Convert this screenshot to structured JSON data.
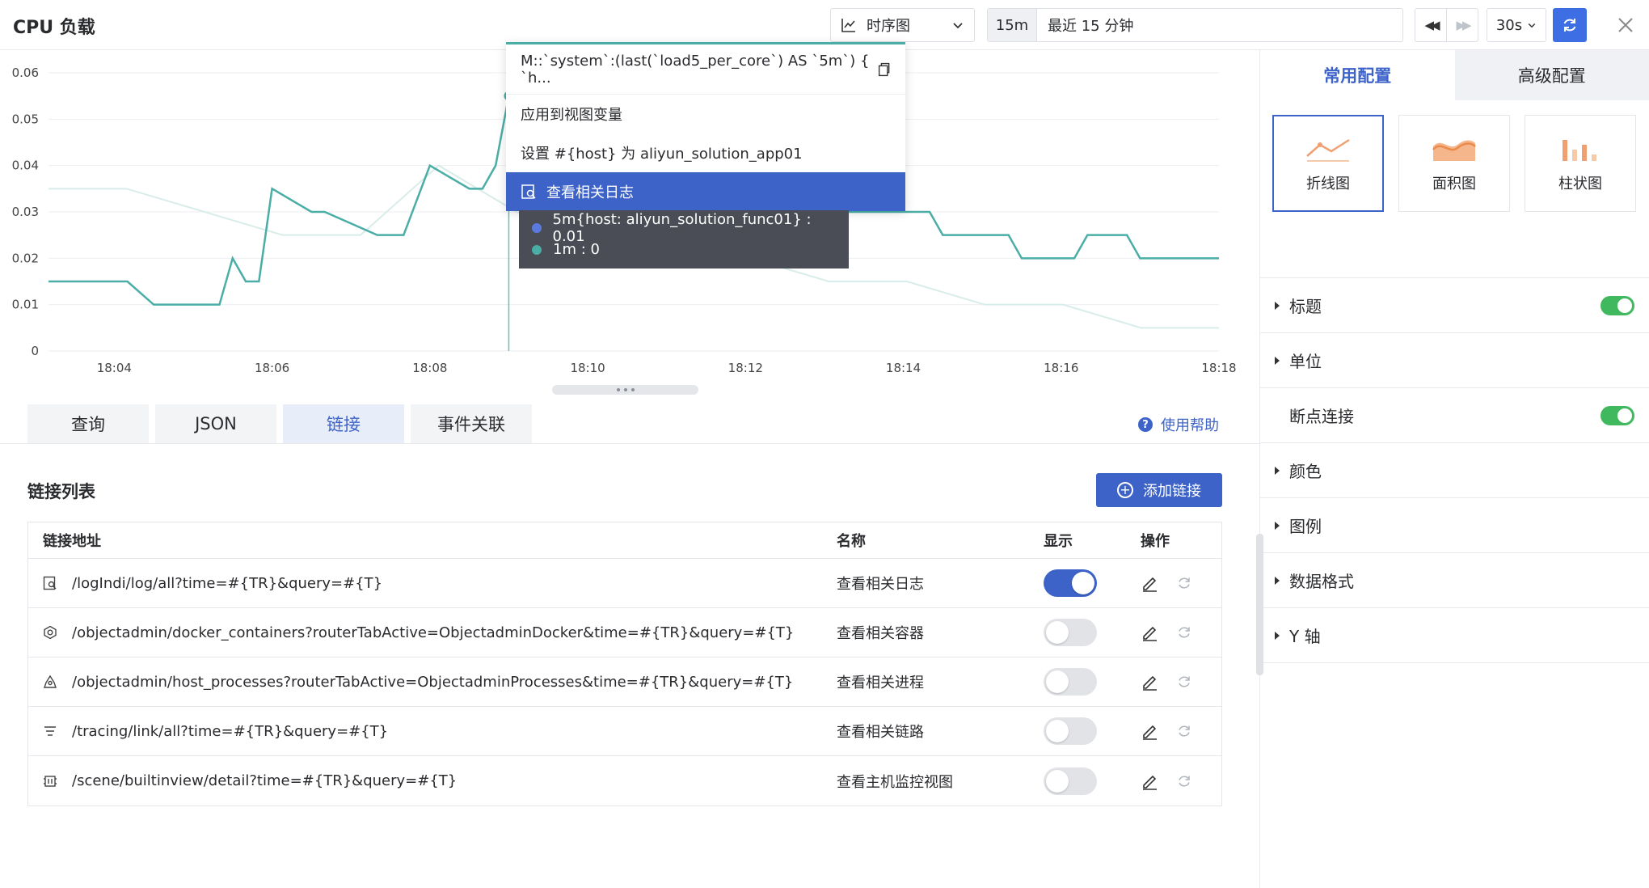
{
  "header": {
    "title": "CPU 负载",
    "viz_type": "时序图",
    "time_short": "15m",
    "time_long": "最近 15 分钟",
    "interval": "30s"
  },
  "colors": {
    "accent": "#3d63c9",
    "series_teal": "#4aada6",
    "series_blue": "#5b7ae0",
    "toggle_green": "#3fb85e"
  },
  "chart": {
    "y_ticks": [
      "0.06",
      "0.05",
      "0.04",
      "0.03",
      "0.02",
      "0.01",
      "0"
    ],
    "x_ticks": [
      "18:04",
      "18:06",
      "18:08",
      "18:10",
      "18:12",
      "18:14",
      "18:16",
      "18:18"
    ]
  },
  "chart_data": {
    "type": "line",
    "ylim": [
      0,
      0.06
    ],
    "series": [
      {
        "name": "1m",
        "color": "#4aada6",
        "x": [
          "18:03:10",
          "18:04:10",
          "18:04:30",
          "18:05:00",
          "18:05:10",
          "18:05:20",
          "18:05:30",
          "18:05:40",
          "18:05:50",
          "18:06:00",
          "18:06:30",
          "18:06:40",
          "18:07:20",
          "18:07:30",
          "18:07:40",
          "18:08:00",
          "18:08:30",
          "18:08:40",
          "18:08:50",
          "18:09:00",
          "18:09:20",
          "18:10:00",
          "18:10:30",
          "18:11:00",
          "18:11:30",
          "18:12:00",
          "18:12:30",
          "18:13:00",
          "18:13:20",
          "18:13:30",
          "18:14:00",
          "18:14:20",
          "18:14:30",
          "18:15:00",
          "18:15:20",
          "18:15:30",
          "18:16:00",
          "18:16:10",
          "18:16:20",
          "18:16:50",
          "18:17:00",
          "18:17:10",
          "18:18:00"
        ],
        "values": [
          0.015,
          0.015,
          0.01,
          0.01,
          0.01,
          0.01,
          0.02,
          0.015,
          0.015,
          0.035,
          0.03,
          0.03,
          0.025,
          0.025,
          0.025,
          0.04,
          0.035,
          0.035,
          0.04,
          0.055,
          0.04,
          0.035,
          0.035,
          0.03,
          0.03,
          0.03,
          0.03,
          0.03,
          0.03,
          0.03,
          0.03,
          0.03,
          0.025,
          0.025,
          0.025,
          0.02,
          0.02,
          0.02,
          0.025,
          0.025,
          0.02,
          0.02,
          0.02
        ]
      },
      {
        "name": "5m{host: aliyun_solution_func01}",
        "color": "#5b7ae0",
        "x": [
          "18:09:00"
        ],
        "values": [
          0.01
        ]
      }
    ]
  },
  "popup": {
    "query": "M::`system`:(last(`load5_per_core`) AS `5m`) { `h...",
    "item_apply": "应用到视图变量",
    "item_set": "设置 #{host} 为 aliyun_solution_app01",
    "item_logs": "查看相关日志"
  },
  "tooltip": {
    "line1": "5m{host: aliyun_solution_func01} : 0.01",
    "line2": "1m : 0"
  },
  "tabs": [
    {
      "label": "查询"
    },
    {
      "label": "JSON"
    },
    {
      "label": "链接"
    },
    {
      "label": "事件关联"
    }
  ],
  "help_label": "使用帮助",
  "links": {
    "title": "链接列表",
    "add_label": "添加链接",
    "headers": {
      "url": "链接地址",
      "name": "名称",
      "show": "显示",
      "op": "操作"
    },
    "rows": [
      {
        "icon": "log-search-icon",
        "url": "/logIndi/log/all?time=#{TR}&query=#{T}",
        "name": "查看相关日志",
        "show": true
      },
      {
        "icon": "container-icon",
        "url": "/objectadmin/docker_containers?routerTabActive=ObjectadminDocker&time=#{TR}&query=#{T}",
        "name": "查看相关容器",
        "show": false
      },
      {
        "icon": "process-icon",
        "url": "/objectadmin/host_processes?routerTabActive=ObjectadminProcesses&time=#{TR}&query=#{T}",
        "name": "查看相关进程",
        "show": false
      },
      {
        "icon": "trace-icon",
        "url": "/tracing/link/all?time=#{TR}&query=#{T}",
        "name": "查看相关链路",
        "show": false
      },
      {
        "icon": "host-icon",
        "url": "/scene/builtinview/detail?time=#{TR}&query=#{T}",
        "name": "查看主机监控视图",
        "show": false
      }
    ]
  },
  "config": {
    "tab_common": "常用配置",
    "tab_advanced": "高级配置",
    "chart_types": [
      {
        "label": "折线图",
        "icon": "line-chart-icon",
        "active": true
      },
      {
        "label": "面积图",
        "icon": "area-chart-icon",
        "active": false
      },
      {
        "label": "柱状图",
        "icon": "bar-chart-icon",
        "active": false
      }
    ],
    "items": [
      {
        "label": "标题",
        "collapsible": true,
        "switch": true
      },
      {
        "label": "单位",
        "collapsible": true,
        "switch": false
      },
      {
        "label": "断点连接",
        "collapsible": false,
        "switch": true
      },
      {
        "label": "颜色",
        "collapsible": true,
        "switch": false
      },
      {
        "label": "图例",
        "collapsible": true,
        "switch": false
      },
      {
        "label": "数据格式",
        "collapsible": true,
        "switch": false
      },
      {
        "label": "Y 轴",
        "collapsible": true,
        "switch": false
      }
    ]
  }
}
